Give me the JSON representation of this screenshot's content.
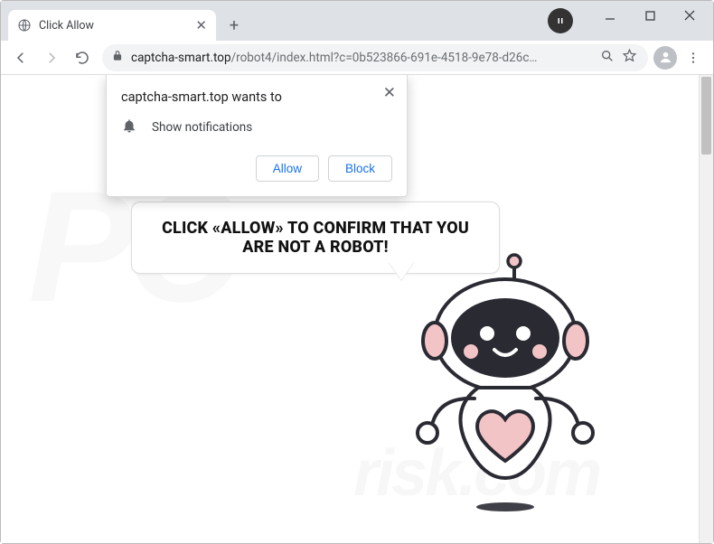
{
  "window": {
    "tab_title": "Click Allow"
  },
  "toolbar": {
    "url_host": "captcha-smart.top",
    "url_path": "/robot4/index.html?c=0b523866-691e-4518-9e78-d26c…"
  },
  "perm": {
    "title": "captcha-smart.top wants to",
    "line": "Show notifications",
    "allow": "Allow",
    "block": "Block"
  },
  "page": {
    "bubble": "CLICK «ALLOW» TO CONFIRM THAT YOU ARE NOT A ROBOT!"
  },
  "watermark": {
    "big": "PC",
    "small": "risk.com"
  }
}
